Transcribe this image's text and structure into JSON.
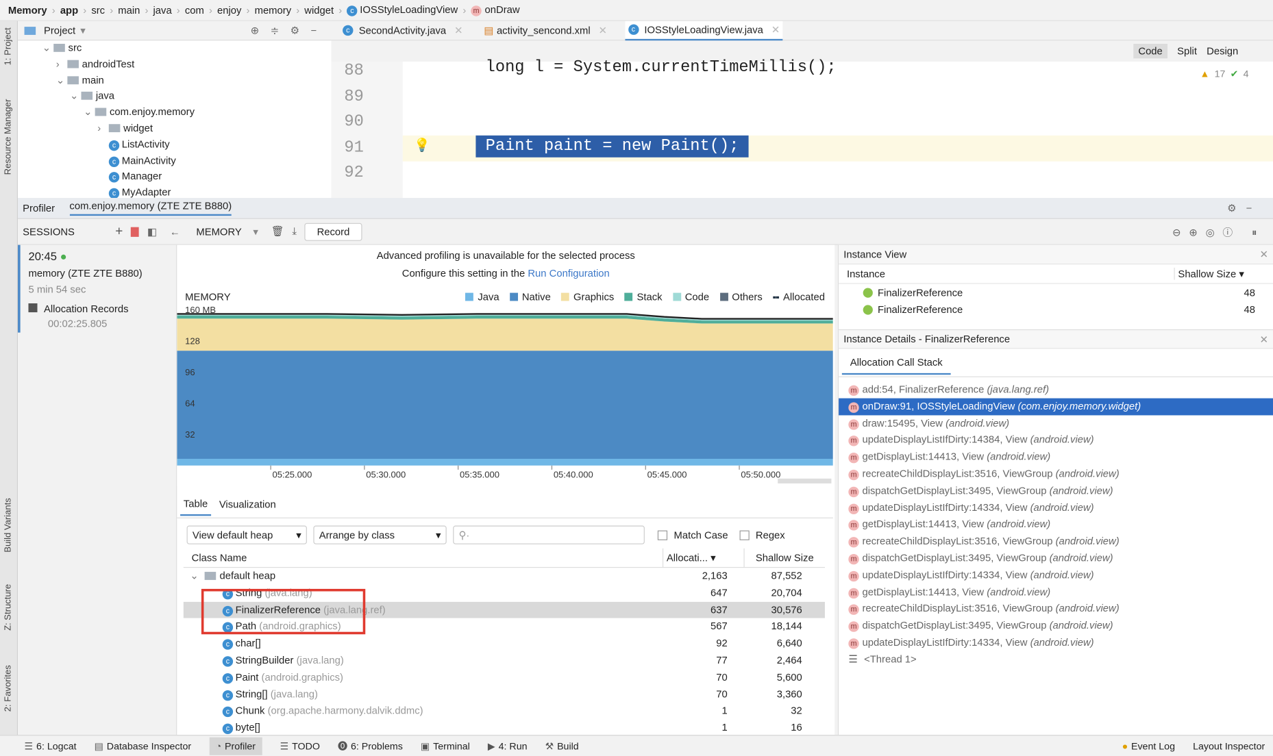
{
  "breadcrumbs": [
    "Memory",
    "app",
    "src",
    "main",
    "java",
    "com",
    "enjoy",
    "memory",
    "widget",
    "IOSStyleLoadingView",
    "onDraw"
  ],
  "left_strip": [
    "1: Project",
    "Resource Manager",
    "Build Variants",
    "Z: Structure",
    "2: Favorites"
  ],
  "project": {
    "title": "Project",
    "tree": [
      {
        "label": "src",
        "depth": 0,
        "type": "folder",
        "open": true
      },
      {
        "label": "androidTest",
        "depth": 1,
        "type": "folder",
        "open": false
      },
      {
        "label": "main",
        "depth": 1,
        "type": "folder",
        "open": true
      },
      {
        "label": "java",
        "depth": 2,
        "type": "folder",
        "open": true
      },
      {
        "label": "com.enjoy.memory",
        "depth": 3,
        "type": "folder",
        "open": true
      },
      {
        "label": "widget",
        "depth": 4,
        "type": "folder",
        "open": false
      },
      {
        "label": "ListActivity",
        "depth": 4,
        "type": "class"
      },
      {
        "label": "MainActivity",
        "depth": 4,
        "type": "class"
      },
      {
        "label": "Manager",
        "depth": 4,
        "type": "class"
      },
      {
        "label": "MyAdapter",
        "depth": 4,
        "type": "class"
      }
    ]
  },
  "editor": {
    "tabs": [
      "SecondActivity.java",
      "activity_sencond.xml",
      "IOSStyleLoadingView.java"
    ],
    "active_tab": 2,
    "view_modes": [
      "Code",
      "Split",
      "Design"
    ],
    "warnings": "17",
    "ok": "4",
    "lines": [
      {
        "n": "88",
        "code": "long l = System.currentTimeMillis();"
      },
      {
        "n": "89",
        "code": ""
      },
      {
        "n": "90",
        "code": ""
      },
      {
        "n": "91",
        "code": "Paint paint = new Paint();"
      },
      {
        "n": "92",
        "code": ""
      }
    ]
  },
  "profiler": {
    "tabs": [
      "Profiler",
      "com.enjoy.memory (ZTE ZTE B880)"
    ],
    "sessions_label": "SESSIONS",
    "monitor": "MEMORY",
    "record": "Record",
    "session": {
      "time": "20:45",
      "name": "memory (ZTE ZTE B880)",
      "duration": "5 min 54 sec",
      "record_label": "Allocation Records",
      "record_time": "00:02:25.805"
    },
    "notice": "Advanced profiling is unavailable for the selected process",
    "notice2": "Configure this setting in the ",
    "notice_link": "Run Configuration"
  },
  "chart_data": {
    "type": "area",
    "title": "MEMORY",
    "ylim": [
      0,
      160
    ],
    "yticks": [
      "160 MB",
      "128",
      "96",
      "64",
      "32"
    ],
    "ytick_values": [
      160,
      128,
      96,
      64,
      32
    ],
    "xticks": [
      "05:25.000",
      "05:30.000",
      "05:35.000",
      "05:40.000",
      "05:45.000",
      "05:50.000"
    ],
    "legend": [
      "Java",
      "Native",
      "Graphics",
      "Stack",
      "Code",
      "Others",
      "Allocated"
    ],
    "colors": {
      "Java": "#6fb7e6",
      "Native": "#4c8ac4",
      "Graphics": "#f3dfa2",
      "Stack": "#4fae9a",
      "Code": "#9fdad6",
      "Others": "#5d6d7e"
    },
    "x_seconds": [
      324,
      328,
      332,
      336,
      340,
      344,
      346,
      348,
      352,
      354
    ],
    "series": [
      {
        "name": "Java",
        "values": [
          7,
          7,
          7,
          7,
          7,
          7,
          7,
          7,
          7,
          7
        ]
      },
      {
        "name": "Native",
        "values": [
          111,
          111,
          111,
          111,
          111,
          111,
          111,
          111,
          111,
          111
        ]
      },
      {
        "name": "Graphics",
        "values": [
          33,
          33,
          32,
          33,
          33,
          33,
          30,
          28,
          28,
          28
        ]
      },
      {
        "name": "Stack",
        "values": [
          3,
          3,
          3,
          3,
          3,
          3,
          3,
          3,
          3,
          3
        ]
      },
      {
        "name": "Code",
        "values": [
          1,
          1,
          1,
          1,
          1,
          1,
          1,
          1,
          1,
          1
        ]
      }
    ]
  },
  "heap": {
    "tabs": [
      "Table",
      "Visualization"
    ],
    "heap_select": "View default heap",
    "arrange_select": "Arrange by class",
    "match_case": "Match Case",
    "regex": "Regex",
    "columns": [
      "Class Name",
      "Allocati...",
      "Shallow Size"
    ],
    "rows": [
      {
        "name": "default heap",
        "pkg": "",
        "alloc": "2,163",
        "size": "87,552",
        "group": true
      },
      {
        "name": "String",
        "pkg": "(java.lang)",
        "alloc": "647",
        "size": "20,704"
      },
      {
        "name": "FinalizerReference",
        "pkg": "(java.lang.ref)",
        "alloc": "637",
        "size": "30,576",
        "selected": true
      },
      {
        "name": "Path",
        "pkg": "(android.graphics)",
        "alloc": "567",
        "size": "18,144"
      },
      {
        "name": "char[]",
        "pkg": "",
        "alloc": "92",
        "size": "6,640"
      },
      {
        "name": "StringBuilder",
        "pkg": "(java.lang)",
        "alloc": "77",
        "size": "2,464"
      },
      {
        "name": "Paint",
        "pkg": "(android.graphics)",
        "alloc": "70",
        "size": "5,600"
      },
      {
        "name": "String[]",
        "pkg": "(java.lang)",
        "alloc": "70",
        "size": "3,360"
      },
      {
        "name": "Chunk",
        "pkg": "(org.apache.harmony.dalvik.ddmc)",
        "alloc": "1",
        "size": "32"
      },
      {
        "name": "byte[]",
        "pkg": "",
        "alloc": "1",
        "size": "16"
      }
    ],
    "highlight_color": "#e03a2f"
  },
  "instance_view": {
    "title": "Instance View",
    "columns": [
      "Instance",
      "Shallow Size"
    ],
    "rows": [
      {
        "name": "FinalizerReference",
        "size": "48"
      },
      {
        "name": "FinalizerReference",
        "size": "48"
      }
    ]
  },
  "details": {
    "title": "Instance Details - FinalizerReference",
    "tab": "Allocation Call Stack",
    "frames": [
      {
        "m": "add:54, FinalizerReference",
        "p": "(java.lang.ref)"
      },
      {
        "m": "onDraw:91, IOSStyleLoadingView",
        "p": "(com.enjoy.memory.widget)",
        "selected": true
      },
      {
        "m": "draw:15495, View",
        "p": "(android.view)"
      },
      {
        "m": "updateDisplayListIfDirty:14384, View",
        "p": "(android.view)"
      },
      {
        "m": "getDisplayList:14413, View",
        "p": "(android.view)"
      },
      {
        "m": "recreateChildDisplayList:3516, ViewGroup",
        "p": "(android.view)"
      },
      {
        "m": "dispatchGetDisplayList:3495, ViewGroup",
        "p": "(android.view)"
      },
      {
        "m": "updateDisplayListIfDirty:14334, View",
        "p": "(android.view)"
      },
      {
        "m": "getDisplayList:14413, View",
        "p": "(android.view)"
      },
      {
        "m": "recreateChildDisplayList:3516, ViewGroup",
        "p": "(android.view)"
      },
      {
        "m": "dispatchGetDisplayList:3495, ViewGroup",
        "p": "(android.view)"
      },
      {
        "m": "updateDisplayListIfDirty:14334, View",
        "p": "(android.view)"
      },
      {
        "m": "getDisplayList:14413, View",
        "p": "(android.view)"
      },
      {
        "m": "recreateChildDisplayList:3516, ViewGroup",
        "p": "(android.view)"
      },
      {
        "m": "dispatchGetDisplayList:3495, ViewGroup",
        "p": "(android.view)"
      },
      {
        "m": "updateDisplayListIfDirty:14334, View",
        "p": "(android.view)"
      }
    ],
    "thread": "<Thread 1>"
  },
  "bottom": {
    "tools": [
      "6: Logcat",
      "Database Inspector",
      "Profiler",
      "TODO",
      "6: Problems",
      "Terminal",
      "4: Run",
      "Build"
    ],
    "active": 2,
    "event_log": "Event Log",
    "layout_inspector": "Layout Inspector"
  }
}
